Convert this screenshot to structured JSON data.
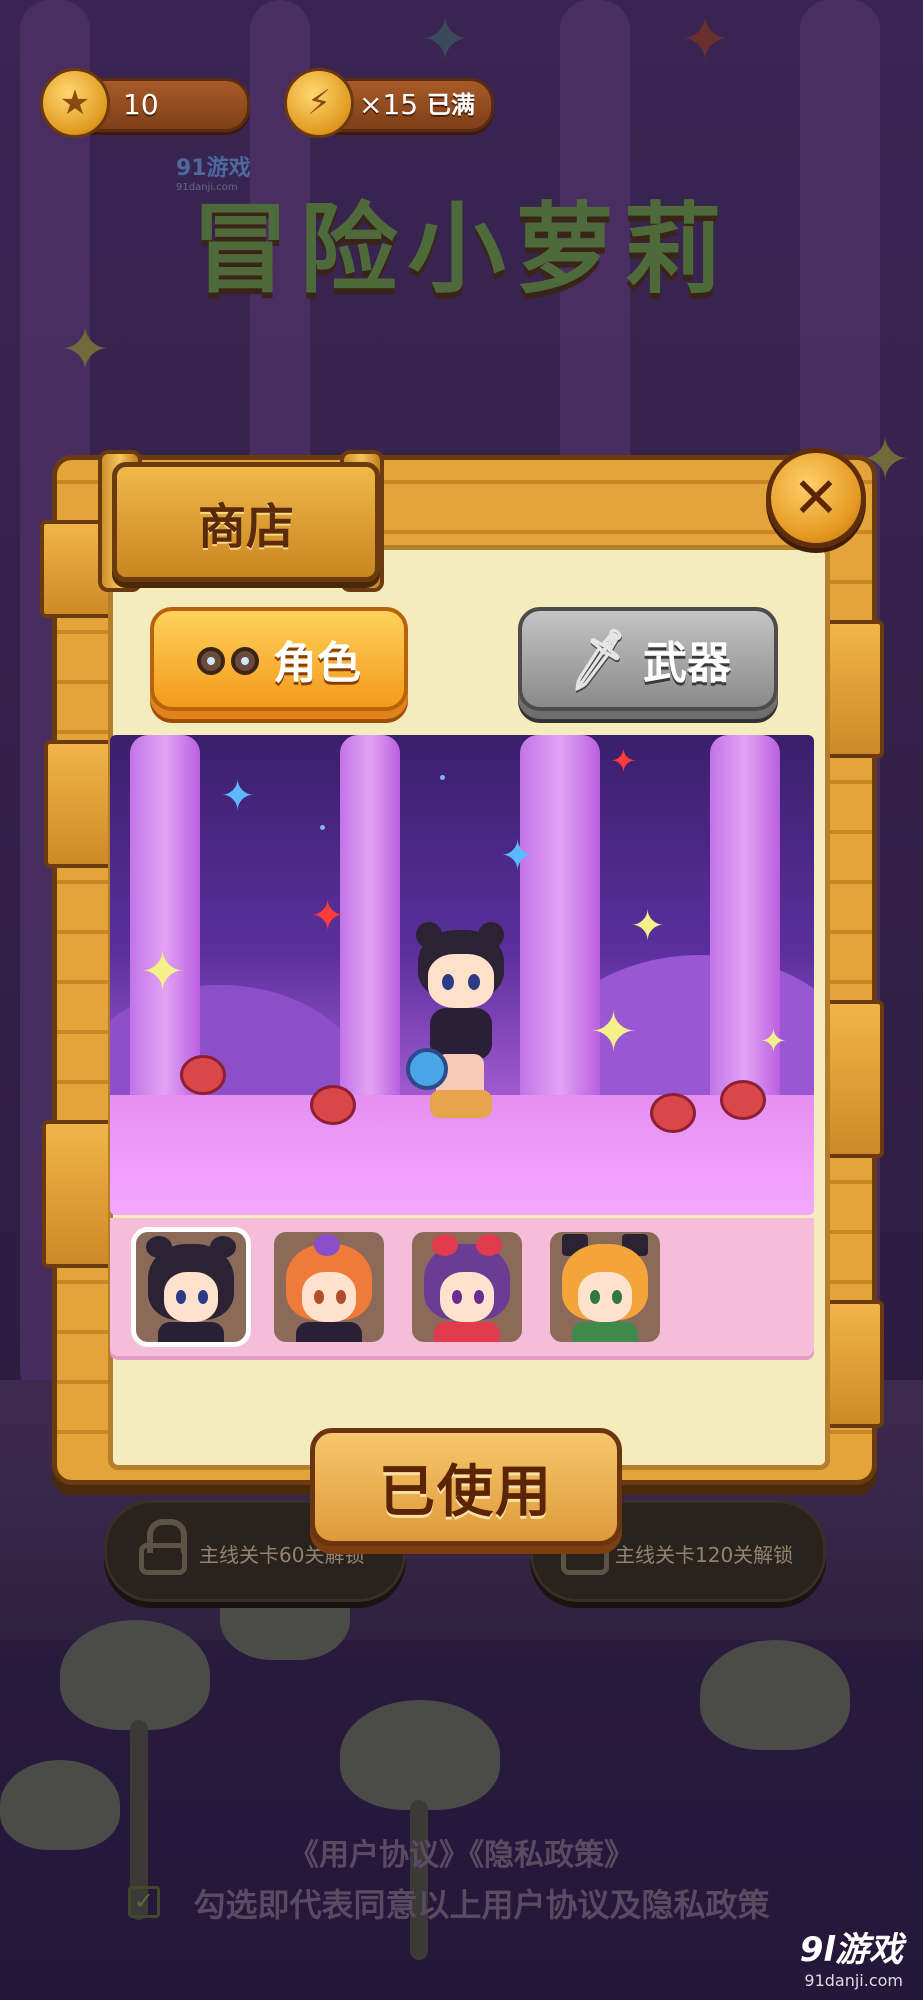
{
  "hud": {
    "coins": "10",
    "energy": "×15",
    "energy_status": "已满"
  },
  "background": {
    "game_title": "冒险小萝莉",
    "brand": "91游戏",
    "brand_sub": "91danji.com",
    "mode_left_lock_text": "主线关卡60关解锁",
    "mode_right_lock_text": "主线关卡120关解锁",
    "legal_links": "《用户协议》《隐私政策》",
    "consent_text": "勾选即代表同意以上用户协议及隐私政策",
    "consent_checked": true
  },
  "shop": {
    "title": "商店",
    "close_label": "✕",
    "tabs": [
      {
        "label": "角色",
        "active": true
      },
      {
        "label": "武器",
        "active": false
      }
    ],
    "characters": [
      {
        "name": "black-hair-girl",
        "selected": true
      },
      {
        "name": "orange-hair-girl",
        "selected": false
      },
      {
        "name": "purple-hair-girl",
        "selected": false
      },
      {
        "name": "blonde-cat-ear-girl",
        "selected": false
      }
    ],
    "action_label": "已使用"
  },
  "watermark": {
    "main": "9l游戏",
    "sub": "91danji.com"
  },
  "colors": {
    "accent_orange": "#f39a1b",
    "wood": "#e3a43a",
    "panel_bg": "#f4ecbd",
    "selector_bg": "#f5bdd9"
  }
}
